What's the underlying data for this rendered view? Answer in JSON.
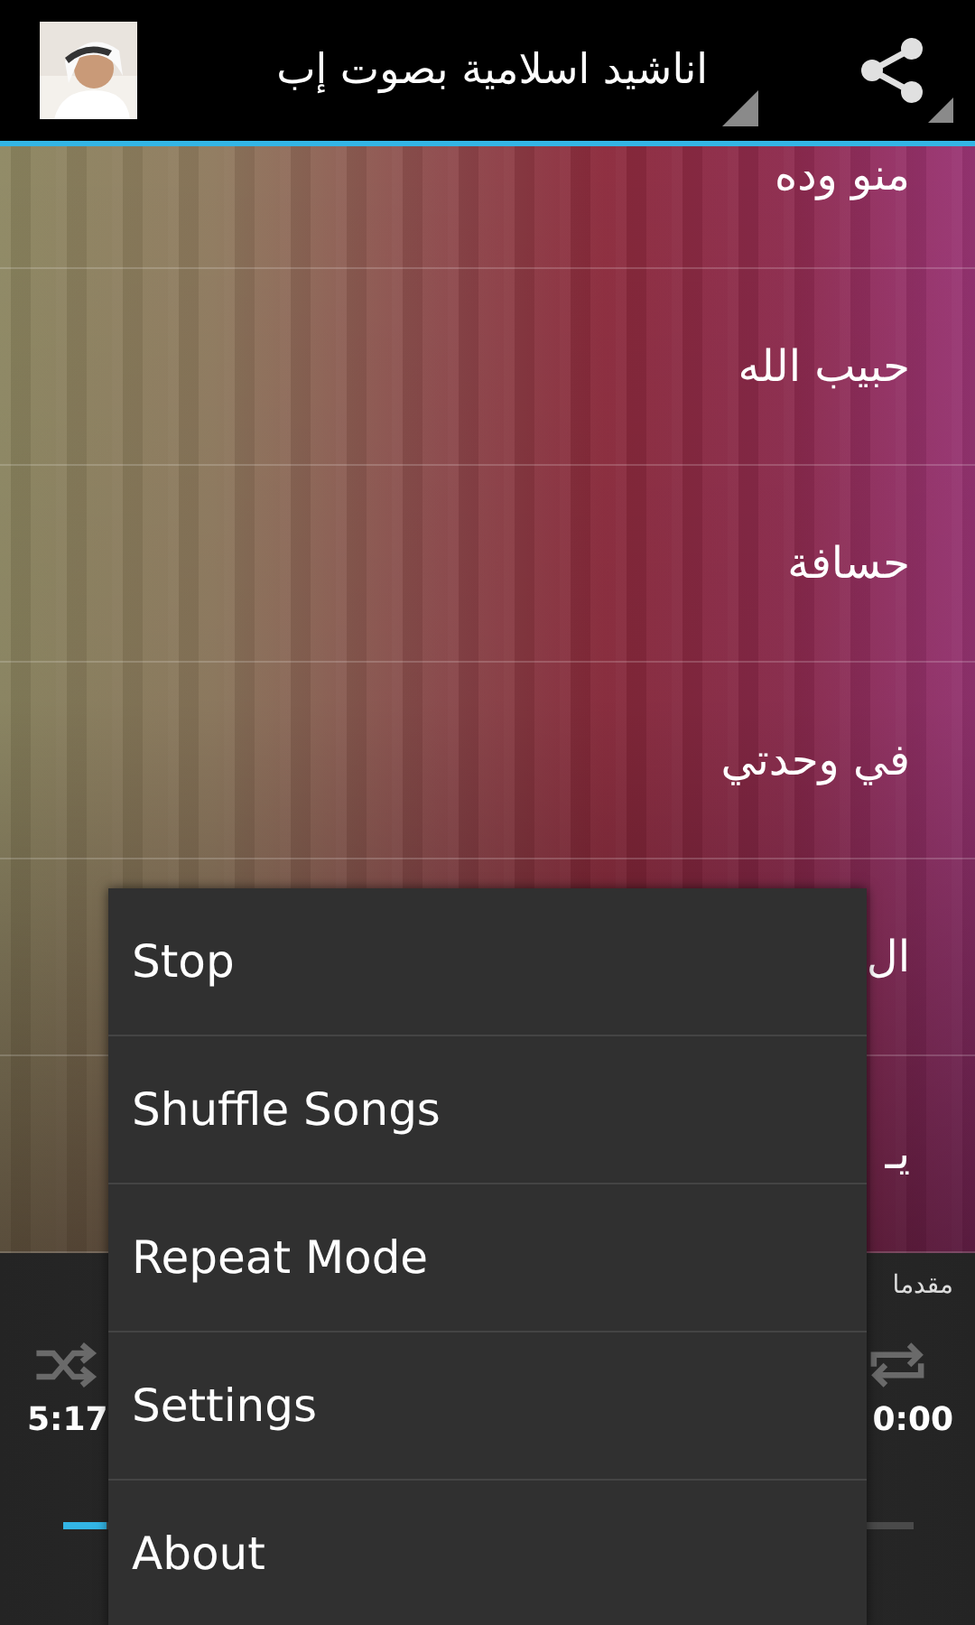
{
  "action_bar": {
    "title": "اناشيد اسلامية بصوت إب"
  },
  "songs": [
    {
      "title": "منو وده"
    },
    {
      "title": "حبيب الله"
    },
    {
      "title": "حسافة"
    },
    {
      "title": "في وحدتي"
    },
    {
      "title": "ال"
    },
    {
      "title": "يـ"
    }
  ],
  "player": {
    "title": "مقدما",
    "elapsed": "5:17",
    "total": "0:00",
    "level": 0.05,
    "shuffle": false,
    "repeat": false
  },
  "menu": [
    {
      "label": "Stop"
    },
    {
      "label": "Shuffle Songs"
    },
    {
      "label": "Repeat Mode"
    },
    {
      "label": "Settings"
    },
    {
      "label": "About"
    }
  ]
}
